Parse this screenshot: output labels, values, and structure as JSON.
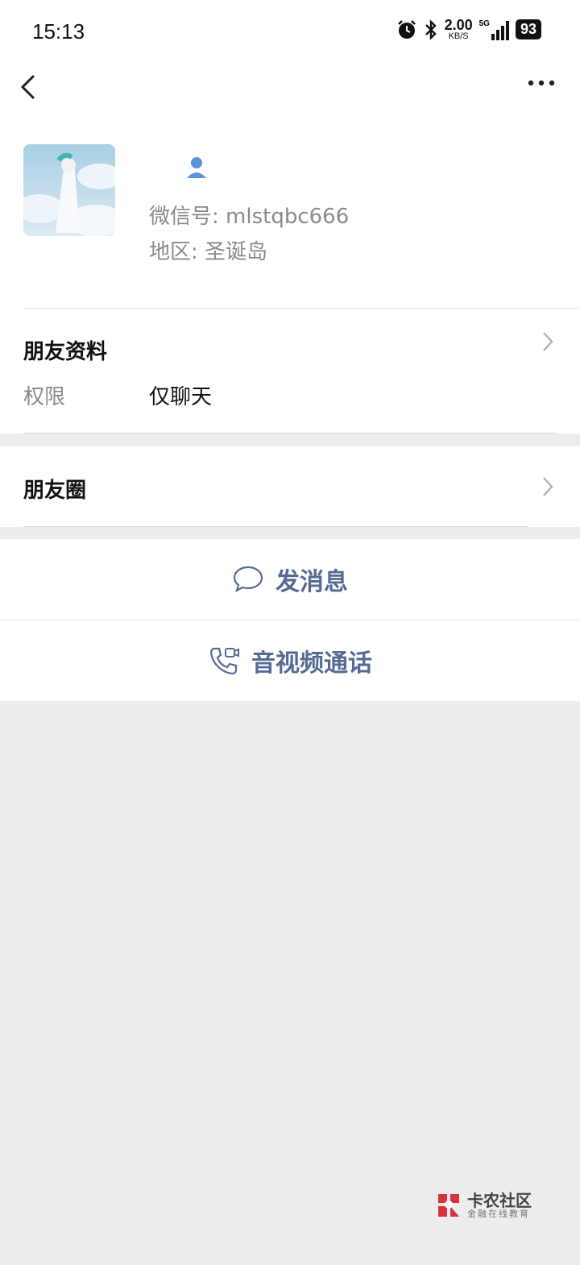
{
  "status_bar": {
    "time": "15:13",
    "net_speed": "2.00",
    "net_unit": "KB/S",
    "signal": "5G",
    "battery": "93"
  },
  "profile": {
    "wechat_id": "微信号: mlstqbc666",
    "region": "地区: 圣诞岛"
  },
  "friend_info": {
    "title": "朋友资料",
    "permission_label": "权限",
    "permission_value": "仅聊天"
  },
  "moments": {
    "title": "朋友圈"
  },
  "actions": {
    "message": "发消息",
    "call": "音视频通话"
  },
  "watermark": {
    "title": "卡农社区",
    "subtitle": "金融在线教育"
  },
  "colors": {
    "accent": "#566b94",
    "background": "#ededed"
  }
}
